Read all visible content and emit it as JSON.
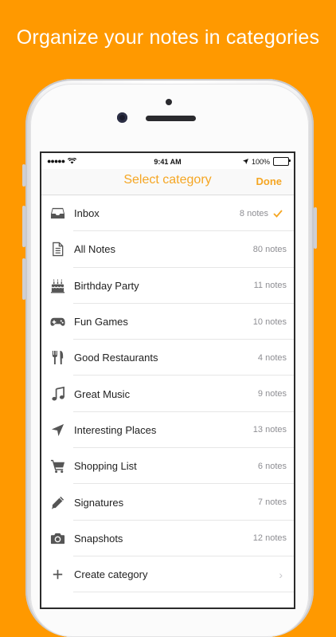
{
  "headline": "Organize your notes in categories",
  "status": {
    "time": "9:41 AM",
    "battery": "100%"
  },
  "nav": {
    "title": "Select category",
    "done": "Done"
  },
  "categories": [
    {
      "label": "Inbox",
      "count": "8 notes",
      "icon": "inbox-icon",
      "selected": true
    },
    {
      "label": "All Notes",
      "count": "80 notes",
      "icon": "document-icon"
    },
    {
      "label": "Birthday Party",
      "count": "11 notes",
      "icon": "cake-icon"
    },
    {
      "label": "Fun Games",
      "count": "10 notes",
      "icon": "gamepad-icon"
    },
    {
      "label": "Good Restaurants",
      "count": "4 notes",
      "icon": "fork-knife-icon"
    },
    {
      "label": "Great Music",
      "count": "9 notes",
      "icon": "music-note-icon"
    },
    {
      "label": "Interesting Places",
      "count": "13 notes",
      "icon": "location-arrow-icon"
    },
    {
      "label": "Shopping List",
      "count": "6 notes",
      "icon": "cart-icon"
    },
    {
      "label": "Signatures",
      "count": "7 notes",
      "icon": "pencil-icon"
    },
    {
      "label": "Snapshots",
      "count": "12 notes",
      "icon": "camera-icon"
    }
  ],
  "create": {
    "label": "Create category",
    "icon": "plus-icon"
  },
  "colors": {
    "accent": "#F5A623",
    "background": "#FF9900",
    "icon": "#555555"
  }
}
